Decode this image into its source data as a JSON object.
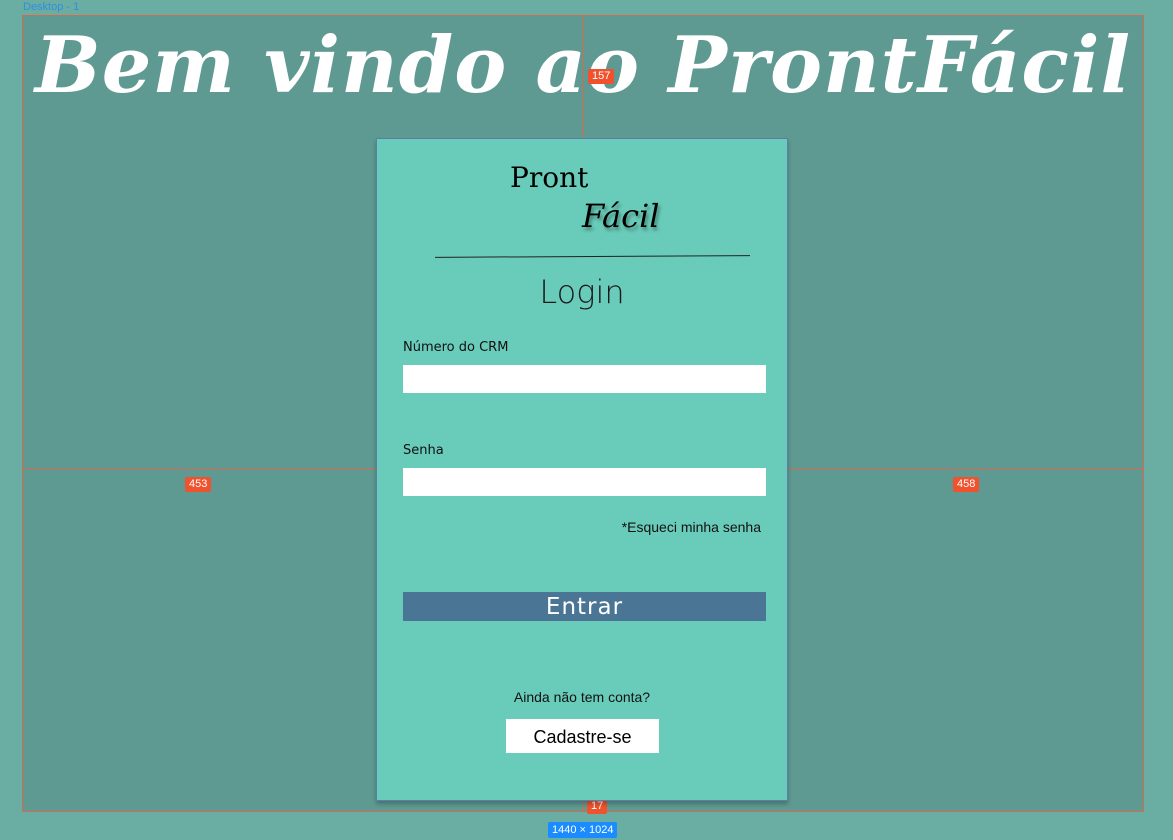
{
  "frame": {
    "label": "Desktop - 1",
    "size_label": "1440 × 1024"
  },
  "measurements": {
    "top": "157",
    "left": "453",
    "right": "458",
    "bottom": "17"
  },
  "welcome": {
    "title": "Bem vindo ao ProntFácil"
  },
  "logo": {
    "line1": "Pront",
    "line2": "Fácil"
  },
  "login": {
    "title": "Login",
    "crm_label": "Número do CRM",
    "crm_value": "",
    "password_label": "Senha",
    "password_value": "",
    "forgot_link": "*Esqueci minha senha",
    "submit_label": "Entrar",
    "no_account_text": "Ainda não tem conta?",
    "register_label": "Cadastre-se"
  },
  "colors": {
    "canvas": "#6aada3",
    "frame": "#5e9a91",
    "card": "#69cbb9",
    "button": "#4a7595",
    "guide": "#d46a4f",
    "badge": "#f0522d",
    "size_badge": "#1a8cff"
  }
}
